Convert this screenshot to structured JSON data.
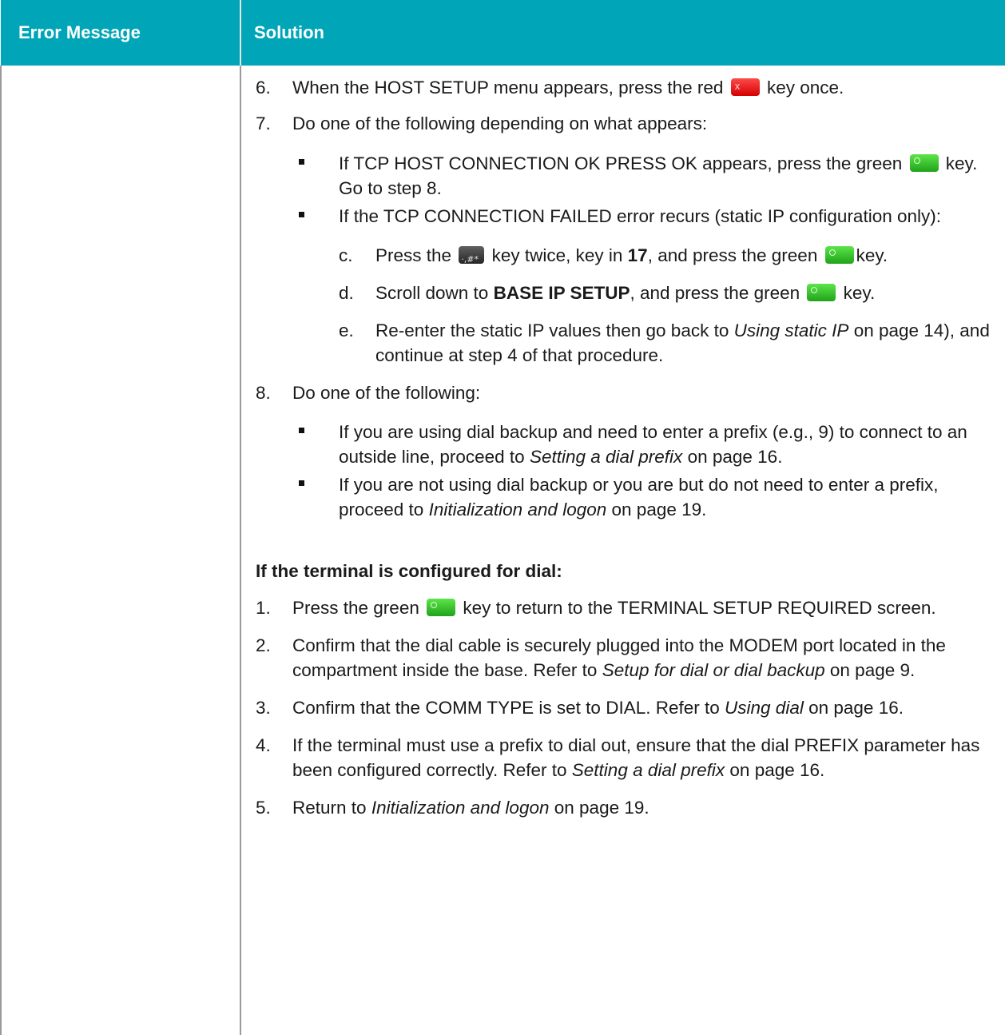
{
  "header": {
    "col1": "Error Message",
    "col2": "Solution"
  },
  "steps_tcp": [
    {
      "num": "6.",
      "a": "When the HOST SETUP menu appears, press the red",
      "b": "key once."
    },
    {
      "num": "7.",
      "text": "Do one of the following depending on what appears:"
    }
  ],
  "bullets_7": [
    {
      "a": "If TCP HOST CONNECTION OK PRESS OK appears, press the green",
      "b": "key. Go to step 8."
    },
    {
      "text": "If the TCP CONNECTION FAILED error recurs (static IP configuration only):"
    }
  ],
  "substeps": {
    "c": {
      "letter": "c.",
      "a": "Press the",
      "b": "key twice, key in",
      "bold": "17",
      "c": ", and press the green",
      "d": "key."
    },
    "d": {
      "letter": "d.",
      "a": "Scroll down to",
      "bold": "BASE IP SETUP",
      "b": ", and press the green",
      "c": "key."
    },
    "e": {
      "letter": "e.",
      "a": "Re-enter the static IP values then go back to",
      "ital": "Using static IP",
      "b": "on page 14), and continue at step 4 of that procedure."
    }
  },
  "step8": {
    "num": "8.",
    "text": "Do one of the following:"
  },
  "bullets_8": [
    {
      "a": "If you are using dial backup and need to enter a prefix (e.g., 9) to connect to an outside line, proceed to",
      "ital": "Setting a dial prefix",
      "b": "on page 16."
    },
    {
      "a": "If you are not using dial backup or you are but do not need to enter a prefix, proceed to",
      "ital": "Initialization and logon",
      "b": "on page 19."
    }
  ],
  "dial_heading": "If the terminal is configured for dial:",
  "dial_steps": [
    {
      "num": "1.",
      "a": "Press the green",
      "b": "key to return to the TERMINAL SETUP REQUIRED screen."
    },
    {
      "num": "2.",
      "a": "Confirm that the dial cable is securely plugged into the MODEM port located in the compartment inside the base. Refer to",
      "ital": "Setup for dial or dial backup",
      "b": "on page 9."
    },
    {
      "num": "3.",
      "a": "Confirm that the COMM TYPE is set to DIAL. Refer to",
      "ital": "Using dial",
      "b": "on page 16."
    },
    {
      "num": "4.",
      "a": "If the terminal must use a prefix to dial out, ensure that the dial PREFIX parameter has been configured correctly. Refer to",
      "ital": "Setting a dial prefix",
      "b": "on page 16."
    },
    {
      "num": "5.",
      "a": "Return to",
      "ital": "Initialization and logon",
      "b": "on page 19."
    }
  ],
  "icons": {
    "red_key": "red-cancel-key-icon",
    "green_key": "green-ok-key-icon",
    "hash_key": "hash-key-icon"
  },
  "colors": {
    "header_bg": "#00a6b7",
    "header_text": "#ffffff",
    "border": "#9a9a9a"
  }
}
